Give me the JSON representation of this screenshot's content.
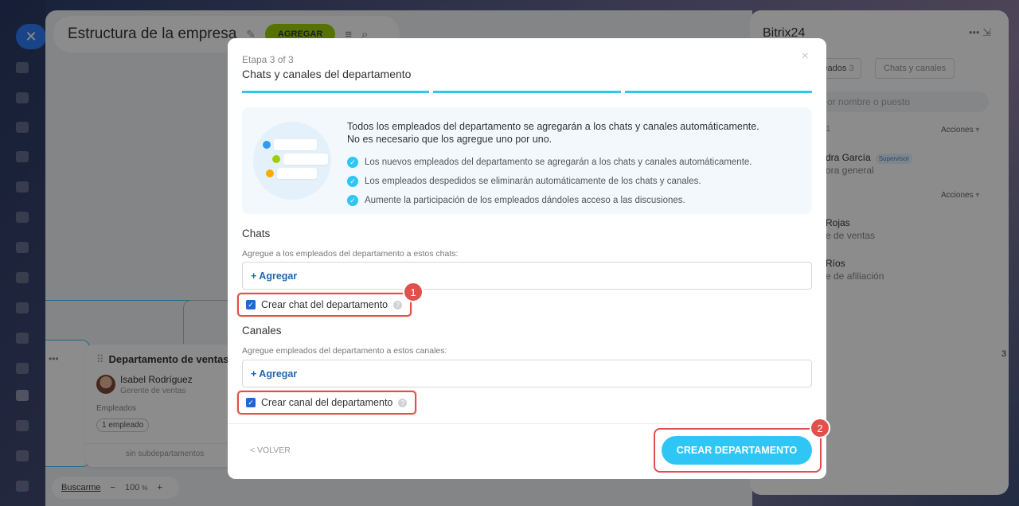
{
  "background": {
    "page_title": "Estructura de la empresa",
    "add_button": "AGREGAR",
    "dept_card": {
      "title": "Departamento de ventas",
      "person_name": "Isabel Rodríguez",
      "person_role": "Gerente de ventas",
      "employees_label": "Empleados",
      "employees_count": "1 empleado",
      "footer": "sin subdepartamentos"
    },
    "footer": {
      "find_me": "Buscarme",
      "zoom_minus": "−",
      "zoom_value": "100",
      "zoom_unit": "%",
      "zoom_plus": "+"
    },
    "right_panel": {
      "title": "Bitrix24",
      "tab_employees": "leados",
      "tab_employees_count": "3",
      "tab_chats": "Chats y canales",
      "search_placeholder": "or nombre o puesto",
      "count_label": "1",
      "actions_label": "Acciones",
      "people": [
        {
          "name": "dra García",
          "badge": "Supervisor",
          "subtitle": "ora general"
        },
        {
          "name": "Rojas",
          "subtitle": "e de ventas"
        },
        {
          "name": "Ríos",
          "subtitle": "e de afiliación"
        }
      ],
      "edge_digit": "3"
    }
  },
  "modal": {
    "step": "Etapa 3 of 3",
    "title": "Chats y canales del departamento",
    "close": "×",
    "info": {
      "heading_line1": "Todos los empleados del departamento se agregarán a los chats y canales automáticamente.",
      "heading_line2": "No es necesario que los agregue uno por uno.",
      "bullets": [
        "Los nuevos empleados del departamento se agregarán a los chats y canales automáticamente.",
        "Los empleados despedidos se eliminarán automáticamente de los chats y canales.",
        "Aumente la participación de los empleados dándoles acceso a las discusiones."
      ]
    },
    "chats": {
      "title": "Chats",
      "description": "Agregue a los empleados del departamento a estos chats:",
      "add_label": "+ Agregar",
      "checkbox_label": "Crear chat del departamento",
      "checked": true
    },
    "channels": {
      "title": "Canales",
      "description": "Agregue empleados del departamento a estos canales:",
      "add_label": "+ Agregar",
      "checkbox_label": "Crear canal del departamento",
      "checked": true
    },
    "back_label": "< VOLVER",
    "create_label": "CREAR DEPARTAMENTO",
    "callouts": [
      "1",
      "2"
    ]
  },
  "colors": {
    "accent": "#2fc6f6",
    "highlight": "#e1504b",
    "link": "#2067b0"
  }
}
